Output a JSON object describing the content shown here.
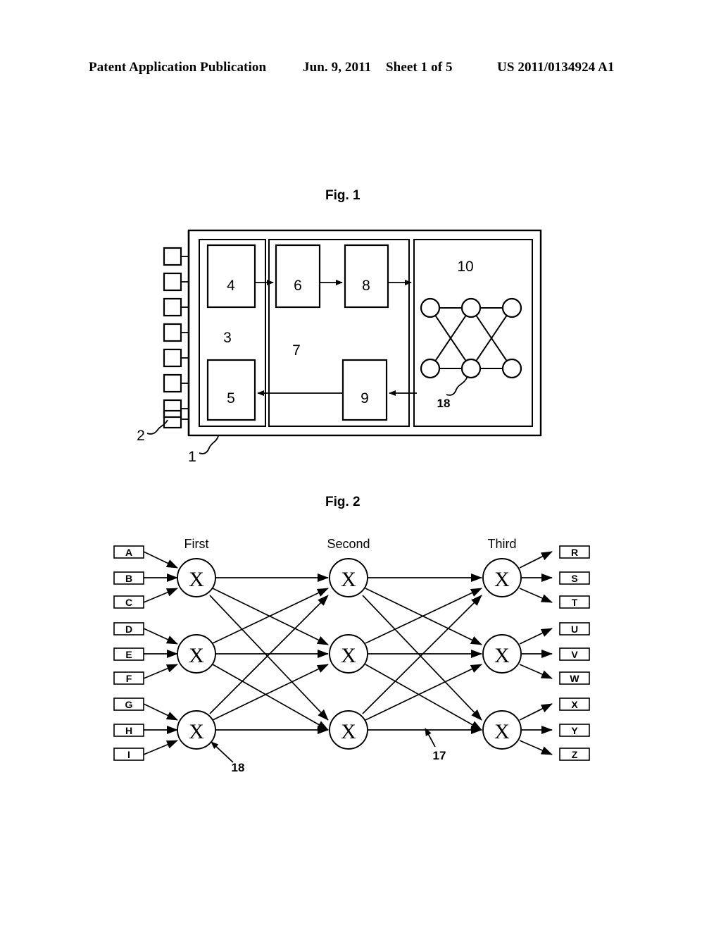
{
  "header": {
    "publication": "Patent Application Publication",
    "date": "Jun. 9, 2011",
    "sheet": "Sheet 1 of 5",
    "number": "US 2011/0134924 A1"
  },
  "figures": [
    {
      "caption": "Fig. 1",
      "outer_label": "1",
      "terminal_label": "2",
      "terminal_count": 8,
      "panels": [
        {
          "label": "3",
          "blocks": [
            "4",
            "5"
          ]
        },
        {
          "label": "7",
          "blocks": [
            "6",
            "8",
            "9"
          ]
        },
        {
          "label": "10",
          "node_ref": "18"
        }
      ],
      "network": {
        "node_count": 6,
        "rows": 2,
        "cols": 3,
        "ref_label": "18"
      }
    },
    {
      "caption": "Fig. 2",
      "layer_labels": [
        "First",
        "Second",
        "Third"
      ],
      "inputs": [
        "A",
        "B",
        "C",
        "D",
        "E",
        "F",
        "G",
        "H",
        "I"
      ],
      "outputs": [
        "R",
        "S",
        "T",
        "U",
        "V",
        "W",
        "X",
        "Y",
        "Z"
      ],
      "node_glyph": "X",
      "nodes_per_layer": 3,
      "layer_count": 3,
      "ref_node": "18",
      "ref_connection": "17"
    }
  ],
  "colors": {
    "ink": "#000000",
    "paper": "#ffffff"
  }
}
